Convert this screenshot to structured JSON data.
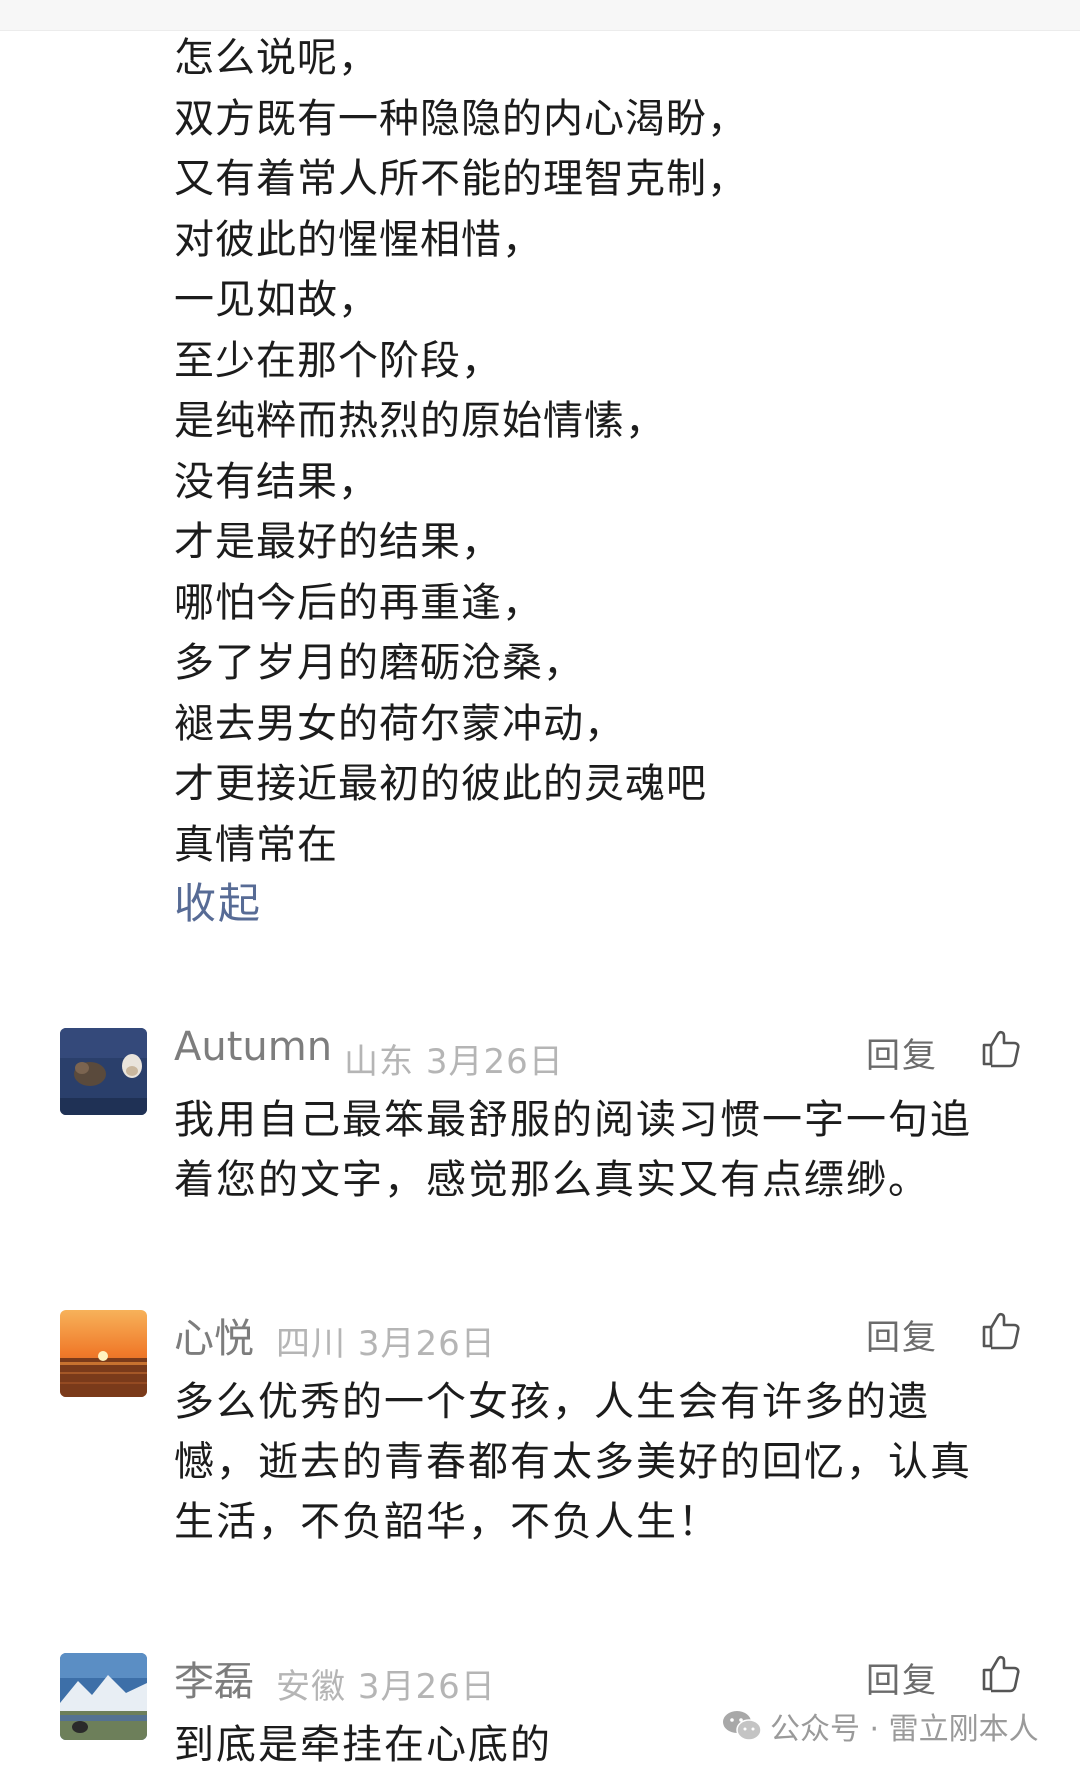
{
  "poem": {
    "lines": [
      "怎么说呢，",
      "双方既有一种隐隐的内心渴盼，",
      "又有着常人所不能的理智克制，",
      "对彼此的惺惺相惜，",
      "一见如故，",
      "至少在那个阶段，",
      "是纯粹而热烈的原始情愫，",
      "没有结果，",
      "才是最好的结果，",
      "哪怕今后的再重逢，",
      "多了岁月的磨砺沧桑，",
      "褪去男女的荷尔蒙冲动，",
      "才更接近最初的彼此的灵魂吧",
      "真情常在"
    ],
    "collapse_label": "收起"
  },
  "comments": [
    {
      "nickname": "Autumn",
      "location": "山东",
      "date": "3月26日",
      "reply_label": "回复",
      "text": "我用自己最笨最舒服的阅读习惯一字一句追着您的文字，感觉那么真实又有点缥缈。",
      "avatar_icon": "cat-photo"
    },
    {
      "nickname": "心悦",
      "location": "四川",
      "date": "3月26日",
      "reply_label": "回复",
      "text": "多么优秀的一个女孩，人生会有许多的遗憾，逝去的青春都有太多美好的回忆，认真生活，不负韶华，不负人生！",
      "avatar_icon": "sunset-photo"
    },
    {
      "nickname": "李磊",
      "location": "安徽",
      "date": "3月26日",
      "reply_label": "回复",
      "text": "到底是牵挂在心底的",
      "avatar_icon": "mountain-photo"
    }
  ],
  "watermark": {
    "text": "公众号 · 雷立刚本人",
    "icon": "wechat-icon"
  },
  "colors": {
    "link": "#576b95",
    "nickname": "#7d7d7d",
    "meta": "#b5b5b5"
  }
}
